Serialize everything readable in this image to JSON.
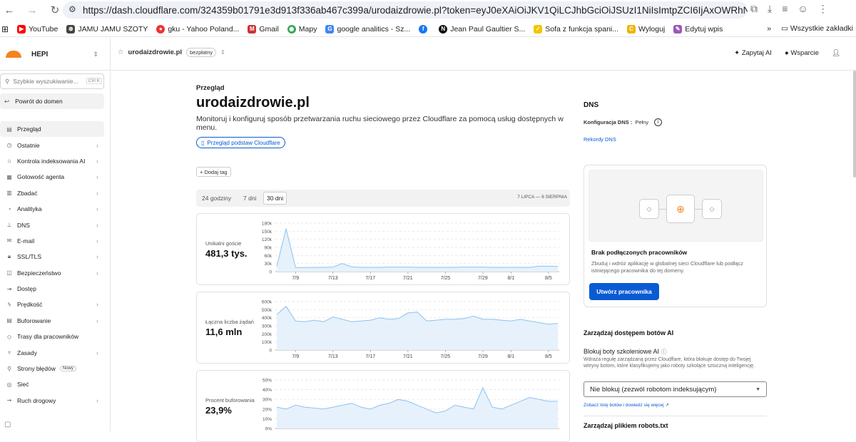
{
  "browser": {
    "url": "https://dash.cloudflare.com/324359b01791e3d913f336ab467c399a/urodaizdrowie.pl?token=eyJ0eXAiOiJKV1QiLCJhbGciOiJSUzI1NiIsImtpZCI6IjAxOWRhNzFkLTJ...",
    "bookmarks": [
      "YouTube",
      "JAMU JAMU SZOTY",
      "gku - Yahoo Poland...",
      "Gmail",
      "Mapy",
      "google analitics - Sz...",
      "",
      "Jean Paul Gaultier S...",
      "Sofa z funkcja spani...",
      "Wyloguj",
      "Edytuj wpis"
    ],
    "bookmarks_more": "»",
    "all_bookmarks": "Wszystkie zakładki"
  },
  "header": {
    "account": "HEPI",
    "zone": "urodaizdrowie.pl",
    "plan": "bezpłatny",
    "ask_ai": "Zapytaj AI",
    "support": "Wsparcie"
  },
  "sidebar": {
    "search_placeholder": "Szybkie wyszukiwanie...",
    "search_kbd": "Ctrl K",
    "back": "Powrót do domen",
    "items": [
      {
        "label": "Przegląd",
        "icon": "▤",
        "chev": false,
        "active": true
      },
      {
        "label": "Ostatnie",
        "icon": "◷",
        "chev": true
      },
      {
        "label": "Kontrola indeksowania AI",
        "icon": "⌂",
        "chev": true
      },
      {
        "label": "Gotowość agenta",
        "icon": "▦",
        "chev": true
      },
      {
        "label": "Zbadać",
        "icon": "▥",
        "chev": true
      },
      {
        "label": "Analityka",
        "icon": "◔",
        "chev": true
      },
      {
        "label": "DNS",
        "icon": "⊥",
        "chev": true
      },
      {
        "label": "E-mail",
        "icon": "✉",
        "chev": true
      },
      {
        "label": "SSL/TLS",
        "icon": "🔒︎",
        "chev": true
      },
      {
        "label": "Bezpieczeństwo",
        "icon": "◫",
        "chev": true
      },
      {
        "label": "Dostęp",
        "icon": "⇥",
        "chev": false
      },
      {
        "label": "Prędkość",
        "icon": "ϟ",
        "chev": true
      },
      {
        "label": "Buforowanie",
        "icon": "▤",
        "chev": true
      },
      {
        "label": "Trasy dla pracowników",
        "icon": "◇",
        "chev": false
      },
      {
        "label": "Zasady",
        "icon": "▿",
        "chev": true
      },
      {
        "label": "Strony błędów",
        "icon": "⚲",
        "chev": false,
        "badge": "Nowy"
      },
      {
        "label": "Sieć",
        "icon": "◎",
        "chev": false
      },
      {
        "label": "Ruch drogowy",
        "icon": "⇝",
        "chev": true
      }
    ]
  },
  "main": {
    "crumb": "Przegląd",
    "title": "urodaizdrowie.pl",
    "desc": "Monitoruj i konfiguruj sposób przetwarzania ruchu sieciowego przez Cloudflare za pomocą usług dostępnych w menu.",
    "overview_link": "Przegląd podstaw Cloudflare",
    "add_tag": "+ Dodaj tag",
    "ranges": [
      "24 godziny",
      "7 dni",
      "30 dni"
    ],
    "date_range": "7 LIPCA — 6 SIERPNIA",
    "metrics": [
      {
        "label": "Unikalni goście",
        "value": "481,3 tys."
      },
      {
        "label": "Łączna liczba żądań",
        "value": "11,6 mln"
      },
      {
        "label": "Procent buforowania",
        "value": "23,9%"
      }
    ]
  },
  "chart_data": [
    {
      "type": "area",
      "title": "Unikalni goście",
      "x": [
        "7/7",
        "7/8",
        "7/9",
        "7/10",
        "7/11",
        "7/12",
        "7/13",
        "7/14",
        "7/15",
        "7/16",
        "7/17",
        "7/18",
        "7/19",
        "7/20",
        "7/21",
        "7/22",
        "7/23",
        "7/24",
        "7/25",
        "7/26",
        "7/27",
        "7/28",
        "7/29",
        "7/30",
        "7/31",
        "8/1",
        "8/2",
        "8/3",
        "8/4",
        "8/5",
        "8/6"
      ],
      "values": [
        20,
        160,
        15,
        15,
        16,
        16,
        17,
        30,
        18,
        16,
        16,
        16,
        17,
        17,
        17,
        16,
        16,
        16,
        16,
        16,
        17,
        17,
        17,
        16,
        16,
        16,
        16,
        16,
        20,
        20,
        19
      ],
      "yticks": [
        "180k",
        "150k",
        "120k",
        "90k",
        "60k",
        "30k",
        "0"
      ],
      "ylim": [
        0,
        180
      ],
      "xticks": [
        "7/9",
        "7/13",
        "7/17",
        "7/21",
        "7/25",
        "7/29",
        "8/1",
        "8/5"
      ],
      "color": "#8cc2f0"
    },
    {
      "type": "area",
      "title": "Łączna liczba żądań",
      "x": [
        "7/7",
        "7/8",
        "7/9",
        "7/10",
        "7/11",
        "7/12",
        "7/13",
        "7/14",
        "7/15",
        "7/16",
        "7/17",
        "7/18",
        "7/19",
        "7/20",
        "7/21",
        "7/22",
        "7/23",
        "7/24",
        "7/25",
        "7/26",
        "7/27",
        "7/28",
        "7/29",
        "7/30",
        "7/31",
        "8/1",
        "8/2",
        "8/3",
        "8/4",
        "8/5",
        "8/6"
      ],
      "values": [
        440,
        540,
        360,
        350,
        370,
        350,
        410,
        380,
        350,
        360,
        370,
        400,
        380,
        390,
        460,
        470,
        360,
        370,
        380,
        380,
        390,
        420,
        380,
        380,
        370,
        360,
        380,
        360,
        340,
        320,
        330
      ],
      "yticks": [
        "600k",
        "500k",
        "400k",
        "300k",
        "200k",
        "100k",
        "0"
      ],
      "ylim": [
        0,
        600
      ],
      "xticks": [
        "7/9",
        "7/13",
        "7/17",
        "7/21",
        "7/25",
        "7/29",
        "8/1",
        "8/5"
      ],
      "color": "#8cc2f0"
    },
    {
      "type": "area",
      "title": "Procent buforowania",
      "x": [
        "7/7",
        "7/8",
        "7/9",
        "7/10",
        "7/11",
        "7/12",
        "7/13",
        "7/14",
        "7/15",
        "7/16",
        "7/17",
        "7/18",
        "7/19",
        "7/20",
        "7/21",
        "7/22",
        "7/23",
        "7/24",
        "7/25",
        "7/26",
        "7/27",
        "7/28",
        "7/29",
        "7/30",
        "7/31",
        "8/1",
        "8/2",
        "8/3",
        "8/4",
        "8/5",
        "8/6"
      ],
      "values": [
        22,
        20,
        24,
        22,
        21,
        20,
        22,
        24,
        26,
        22,
        20,
        24,
        26,
        30,
        28,
        24,
        20,
        16,
        18,
        24,
        22,
        20,
        42,
        22,
        20,
        24,
        28,
        32,
        30,
        28,
        28
      ],
      "yticks": [
        "50%",
        "40%",
        "30%",
        "20%",
        "10%",
        "0%"
      ],
      "ylim": [
        0,
        50
      ],
      "xticks": [],
      "color": "#8cc2f0"
    }
  ],
  "right": {
    "dns_title": "DNS",
    "dns_config_label": "Konfiguracja DNS :",
    "dns_config_value": "Pełny",
    "dns_records_link": "Rekordy DNS",
    "workers_title": "Brak podłączonych pracowników",
    "workers_desc": "Zbuduj i wdróż aplikację w globalnej sieci Cloudflare lub podłącz istniejącego pracownika do tej domeny.",
    "workers_cta": "Utwórz pracownika",
    "bots_title": "Zarządzaj dostępem botów AI",
    "block_title": "Blokuj boty szkoleniowe AI",
    "block_desc": "Wdraża regułę zarządzaną przez Cloudflare, która blokuje dostęp do Twojej witryny botom, które klasyfikujemy jako roboty szkolące sztuczną inteligencję.",
    "select_value": "Nie blokuj (zezwól robotom indeksującym)",
    "bots_list_link": "Zobacz listę botów i dowiedz się więcej",
    "robots_title": "Zarządzaj plikiem robots.txt"
  }
}
